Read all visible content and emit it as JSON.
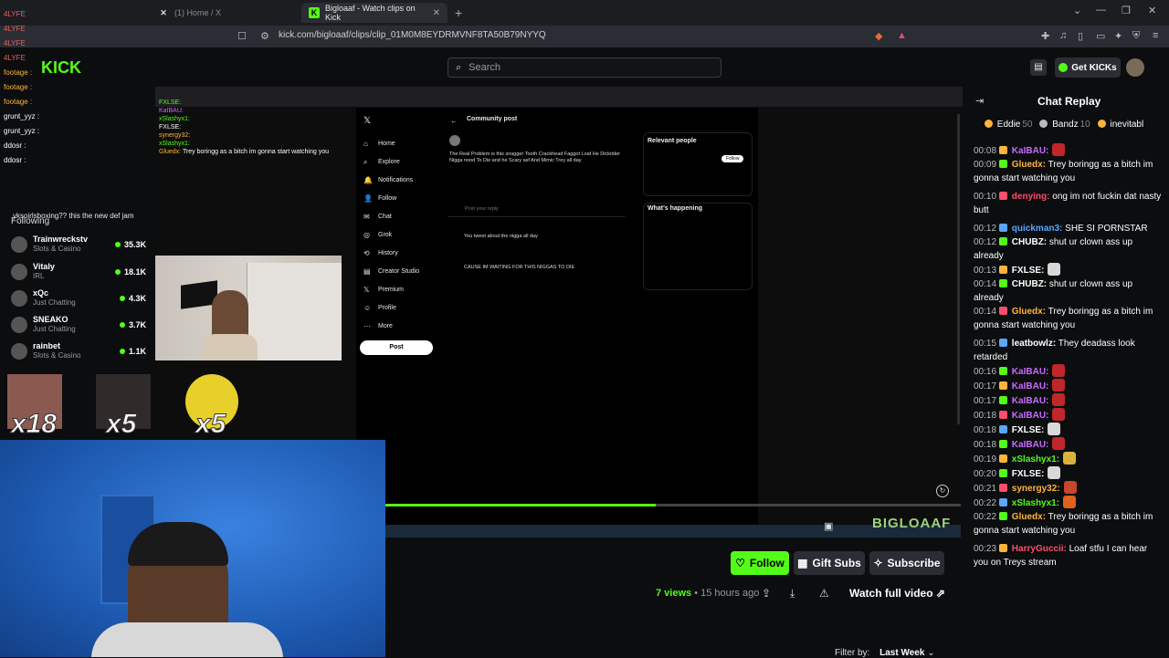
{
  "browser": {
    "tabs": [
      {
        "title": "(1) Home / X",
        "active": false
      },
      {
        "title": "Bigloaaf - Watch clips on Kick",
        "active": true
      }
    ],
    "url": "kick.com/bigloaaf/clips/clip_01M0M8EYDRMVNF8TA50B79NYYQ"
  },
  "header": {
    "search_placeholder": "Search",
    "get_kicks": "Get KICKs"
  },
  "video_overlay": {
    "x_nav": [
      "Home",
      "Explore",
      "Notifications",
      "Follow",
      "Chat",
      "Grok",
      "History",
      "Creator Studio",
      "Premium",
      "Profile",
      "More"
    ],
    "x_post_button": "Post",
    "community_post": "Community post",
    "post_text": "The Real Problem is this snagger Tooth Crackhead Faggot Loaf He Dickrider Nigga nood To Die and he Scary asf And Mimic Trey all day",
    "reply_placeholder": "Post your reply",
    "reply1": "You tweet about the nigga all day",
    "reply2": "CAUSE IM WAITING FOR THIS NIGGAS TO DIE",
    "relevant_people": "Relevant people",
    "whats_happening": "What's happening",
    "follow_small": "Follow",
    "stream_chat": [
      {
        "user": "FXLSE:",
        "text": ""
      },
      {
        "user": "KaIBAU:",
        "text": ""
      },
      {
        "user": "xSlashyx1:",
        "text": ""
      },
      {
        "user": "FXLSE:",
        "text": ""
      },
      {
        "user": "synergy32:",
        "text": ""
      },
      {
        "user": "xSlashyx1:",
        "text": ""
      },
      {
        "user": "Gluedx:",
        "text": "Trey boringg as a bitch im gonna start watching you"
      }
    ]
  },
  "left_overlay": {
    "chat_lines": [
      "4LYFE",
      "4LYFE",
      "4LYFE",
      "4LYFE",
      "footage :",
      "footage :",
      "footage :",
      "grunt_yyz :",
      "grunt_yyz :",
      "ddosr :",
      "ddosr :"
    ],
    "unselfish_line": "yksoirlsboxing?? this the new def jam",
    "following_label": "Following",
    "streams": [
      {
        "name": "Trainwreckstv",
        "category": "Slots & Casino",
        "viewers": "35.3K"
      },
      {
        "name": "Vitaly",
        "category": "IRL",
        "viewers": "18.1K"
      },
      {
        "name": "xQc",
        "category": "Just Chatting",
        "viewers": "4.3K"
      },
      {
        "name": "SNEAKO",
        "category": "Just Chatting",
        "viewers": "3.7K"
      },
      {
        "name": "rainbet",
        "category": "Slots & Casino",
        "viewers": "1.1K"
      }
    ],
    "emote_multipliers": [
      "x18",
      "x5",
      "x5"
    ]
  },
  "clip_actions": {
    "follow": "Follow",
    "gift_subs": "Gift Subs",
    "subscribe": "Subscribe",
    "views": "7 views",
    "age": "15 hours ago",
    "watch_full": "Watch full video",
    "filter_label": "Filter by:",
    "filter_value": "Last Week"
  },
  "chat": {
    "title": "Chat Replay",
    "gifters": [
      {
        "name": "Eddie",
        "count": "50"
      },
      {
        "name": "Bandz",
        "count": "10"
      },
      {
        "name": "inevitabl",
        "count": ""
      }
    ],
    "messages": [
      {
        "time": "00:08",
        "user": "KaIBAU:",
        "color": "#c86bff",
        "text": "",
        "emote": "#c0262c"
      },
      {
        "time": "00:09",
        "user": "Gluedx:",
        "color": "#ffb43b",
        "text": "Trey boringg as a bitch im gonna start watching you",
        "emote": ""
      },
      {
        "time": "00:10",
        "user": "denying:",
        "color": "#ff4d6d",
        "text": "ong im not fuckin dat nasty butt",
        "emote": ""
      },
      {
        "time": "00:12",
        "user": "quickman3:",
        "color": "#5aa7ff",
        "text": "SHE SI PORNSTAR",
        "emote": ""
      },
      {
        "time": "00:12",
        "user": "CHUBZ:",
        "color": "#ffffff",
        "text": "shut ur clown ass up already",
        "emote": ""
      },
      {
        "time": "00:13",
        "user": "FXLSE:",
        "color": "#ffffff",
        "text": "",
        "emote": "#d8d8d8"
      },
      {
        "time": "00:14",
        "user": "CHUBZ:",
        "color": "#ffffff",
        "text": "shut ur clown ass up already",
        "emote": ""
      },
      {
        "time": "00:14",
        "user": "Gluedx:",
        "color": "#ffb43b",
        "text": "Trey boringg as a bitch im gonna start watching you",
        "emote": ""
      },
      {
        "time": "00:15",
        "user": "leatbowlz:",
        "color": "#ffffff",
        "text": "They deadass look retarded",
        "emote": ""
      },
      {
        "time": "00:16",
        "user": "KaIBAU:",
        "color": "#c86bff",
        "text": "",
        "emote": "#c0262c"
      },
      {
        "time": "00:17",
        "user": "KaIBAU:",
        "color": "#c86bff",
        "text": "",
        "emote": "#c0262c"
      },
      {
        "time": "00:17",
        "user": "KaIBAU:",
        "color": "#c86bff",
        "text": "",
        "emote": "#c0262c"
      },
      {
        "time": "00:18",
        "user": "KaIBAU:",
        "color": "#c86bff",
        "text": "",
        "emote": "#c0262c"
      },
      {
        "time": "00:18",
        "user": "FXLSE:",
        "color": "#ffffff",
        "text": "",
        "emote": "#d8d8d8"
      },
      {
        "time": "00:18",
        "user": "KaIBAU:",
        "color": "#c86bff",
        "text": "",
        "emote": "#c0262c"
      },
      {
        "time": "00:19",
        "user": "xSlashyx1:",
        "color": "#53fc18",
        "text": "",
        "emote": "#d8b23a"
      },
      {
        "time": "00:20",
        "user": "FXLSE:",
        "color": "#ffffff",
        "text": "",
        "emote": "#d8d8d8"
      },
      {
        "time": "00:21",
        "user": "synergy32:",
        "color": "#ffb43b",
        "text": "",
        "emote": "#c8462a"
      },
      {
        "time": "00:22",
        "user": "xSlashyx1:",
        "color": "#53fc18",
        "text": "",
        "emote": "#e0601e"
      },
      {
        "time": "00:22",
        "user": "Gluedx:",
        "color": "#ffb43b",
        "text": "Trey boringg as a bitch im gonna start watching you",
        "emote": ""
      },
      {
        "time": "00:23",
        "user": "HarryGuccii:",
        "color": "#ff4d6d",
        "text": "Loaf stfu I can hear you on Treys stream",
        "emote": ""
      }
    ]
  },
  "progress": {
    "fraction": 0.47
  }
}
